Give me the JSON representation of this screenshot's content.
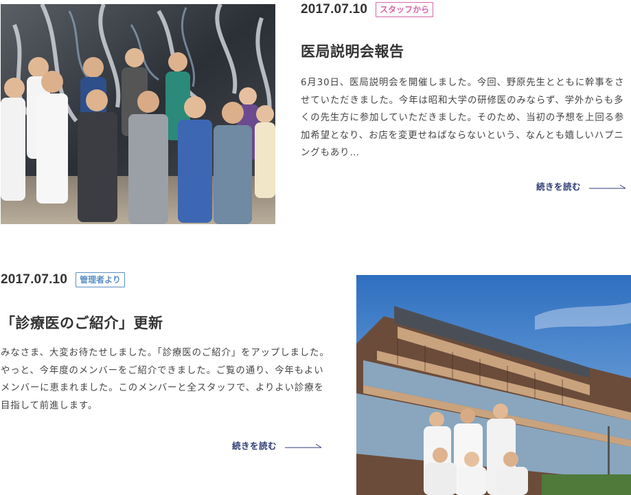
{
  "colors": {
    "text": "#333333",
    "readmore": "#2f3c74",
    "tag_staff": "#d667a6",
    "tag_admin": "#5b8fc4",
    "arrow": "#2f3c74"
  },
  "posts": [
    {
      "date": "2017.07.10",
      "tag": "スタッフから",
      "title": "医局説明会報告",
      "excerpt": "6月30日、医局説明会を開催しました。今回、野原先生とともに幹事をさせていただきました。今年は昭和大学の研修医のみならず、学外からも多くの先生方に参加していただきました。そのため、当初の予想を上回る参加希望となり、お店を変更せねばならないという、なんとも嬉しいハプニングもあり…",
      "read_more": "続きを読む",
      "image_alt": "医局説明会の集合写真"
    },
    {
      "date": "2017.07.10",
      "tag": "管理者より",
      "title": "「診療医のご紹介」更新",
      "excerpt": "みなさま、大変お待たせしました。「診療医のご紹介」をアップしました。やっと、今年度のメンバーをご紹介できました。ご覧の通り、今年もよいメンバーに恵まれました。このメンバーと全スタッフで、よりよい診療を目指して前進します。",
      "read_more": "続きを読む",
      "image_alt": "病院前の診療医集合写真"
    }
  ]
}
